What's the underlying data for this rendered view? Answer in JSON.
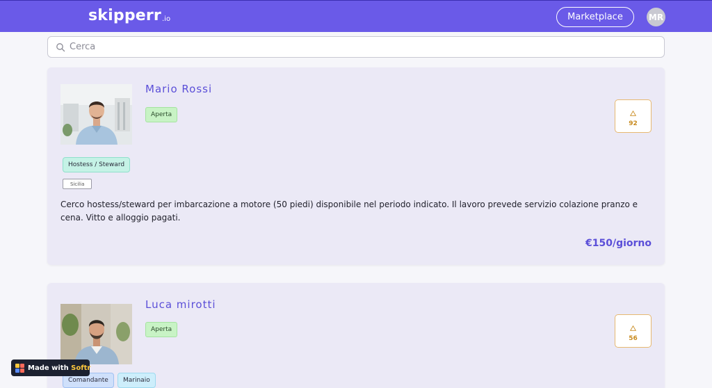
{
  "header": {
    "logo_main": "skipperr",
    "logo_tld": ".io",
    "marketplace_label": "Marketplace",
    "avatar_initials": "MR"
  },
  "search": {
    "placeholder": "Cerca",
    "value": ""
  },
  "listings": [
    {
      "name": "Mario Rossi",
      "status": "Aperta",
      "score": "92",
      "tags": [
        "Hostess / Steward"
      ],
      "location": "Sicilia",
      "description": "Cerco hostess/steward per imbarcazione a motore (50 piedi) disponibile nel periodo indicato. Il lavoro prevede servizio colazione pranzo e cena. Vitto e alloggio pagati.",
      "price": "€150/giorno"
    },
    {
      "name": "Luca mirotti",
      "status": "Aperta",
      "score": "56",
      "tags": [
        "Comandante",
        "Marinaio"
      ]
    }
  ],
  "badge": {
    "prefix": "Made with ",
    "brand": "Softr"
  },
  "colors": {
    "navbar": "#6a5ae8",
    "accent": "#5b4fd8",
    "card_bg": "#ebe9f6",
    "status_green": "#c8f3c5",
    "score_border": "#e7b870"
  },
  "icons": [
    "search-icon",
    "triangle-up-icon",
    "softr-logo-icon"
  ]
}
